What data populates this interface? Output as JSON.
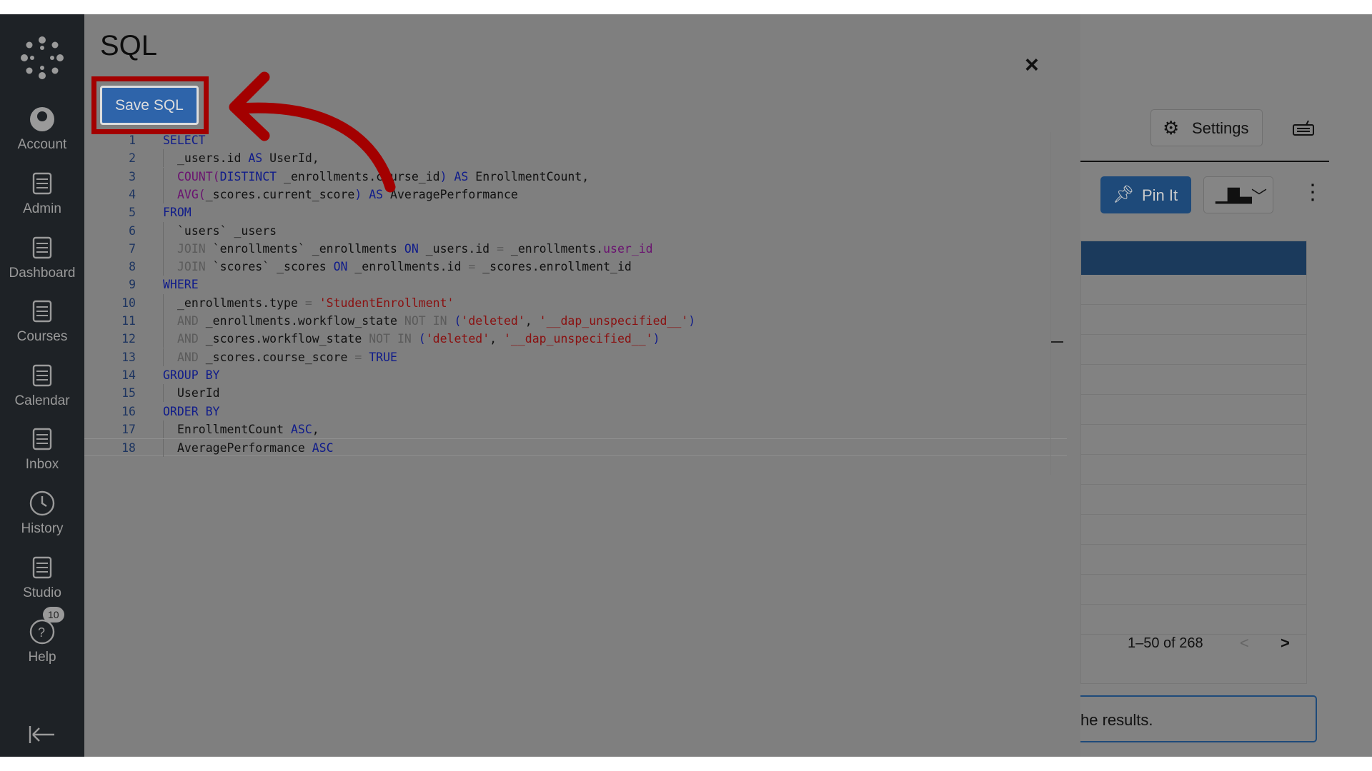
{
  "sidebar": {
    "items": [
      {
        "label": "Account",
        "icon": "account-icon"
      },
      {
        "label": "Admin",
        "icon": "admin-icon"
      },
      {
        "label": "Dashboard",
        "icon": "dashboard-icon"
      },
      {
        "label": "Courses",
        "icon": "courses-icon"
      },
      {
        "label": "Calendar",
        "icon": "calendar-icon"
      },
      {
        "label": "Inbox",
        "icon": "inbox-icon"
      },
      {
        "label": "History",
        "icon": "history-icon"
      },
      {
        "label": "Studio",
        "icon": "studio-icon"
      },
      {
        "label": "Help",
        "icon": "help-icon",
        "badge": "10"
      }
    ]
  },
  "modal": {
    "title": "SQL",
    "close": "×",
    "save_label": "Save SQL"
  },
  "code": [
    [
      [
        "k",
        "SELECT"
      ]
    ],
    [
      [
        "",
        "_users.id "
      ],
      [
        "k",
        "AS"
      ],
      [
        "",
        " UserId,"
      ]
    ],
    [
      [
        "f",
        "COUNT("
      ],
      [
        "k",
        "DISTINCT"
      ],
      [
        "",
        " _enrollments.course_id"
      ],
      [
        "k",
        ")"
      ],
      [
        "",
        " "
      ],
      [
        "k",
        "AS"
      ],
      [
        "",
        " EnrollmentCount,"
      ]
    ],
    [
      [
        "f",
        "AVG("
      ],
      [
        "",
        "_scores.current_score"
      ],
      [
        "k",
        ")"
      ],
      [
        "",
        " "
      ],
      [
        "k",
        "AS"
      ],
      [
        "",
        " AveragePerformance"
      ]
    ],
    [
      [
        "k",
        "FROM"
      ]
    ],
    [
      [
        "",
        "`users` _users"
      ]
    ],
    [
      [
        "o",
        "JOIN"
      ],
      [
        "",
        " `enrollments` _enrollments "
      ],
      [
        "k",
        "ON"
      ],
      [
        "",
        " _users.id "
      ],
      [
        "o",
        "="
      ],
      [
        "",
        " _enrollments."
      ],
      [
        "f",
        "user_id"
      ]
    ],
    [
      [
        "o",
        "JOIN"
      ],
      [
        "",
        " `scores` _scores "
      ],
      [
        "k",
        "ON"
      ],
      [
        "",
        " _enrollments.id "
      ],
      [
        "o",
        "="
      ],
      [
        "",
        " _scores.enrollment_id"
      ]
    ],
    [
      [
        "k",
        "WHERE"
      ]
    ],
    [
      [
        "",
        "_enrollments.type "
      ],
      [
        "o",
        "="
      ],
      [
        "",
        " "
      ],
      [
        "s",
        "'StudentEnrollment'"
      ]
    ],
    [
      [
        "o",
        "AND"
      ],
      [
        "",
        " _enrollments.workflow_state "
      ],
      [
        "o",
        "NOT IN"
      ],
      [
        "",
        " "
      ],
      [
        "k",
        "("
      ],
      [
        "s",
        "'deleted'"
      ],
      [
        "",
        ", "
      ],
      [
        "s",
        "'__dap_unspecified__'"
      ],
      [
        "k",
        ")"
      ]
    ],
    [
      [
        "o",
        "AND"
      ],
      [
        "",
        " _scores.workflow_state "
      ],
      [
        "o",
        "NOT IN"
      ],
      [
        "",
        " "
      ],
      [
        "k",
        "("
      ],
      [
        "s",
        "'deleted'"
      ],
      [
        "",
        ", "
      ],
      [
        "s",
        "'__dap_unspecified__'"
      ],
      [
        "k",
        ")"
      ]
    ],
    [
      [
        "o",
        "AND"
      ],
      [
        "",
        " _scores.course_score "
      ],
      [
        "o",
        "="
      ],
      [
        "",
        " "
      ],
      [
        "k",
        "TRUE"
      ]
    ],
    [
      [
        "k",
        "GROUP BY"
      ]
    ],
    [
      [
        "",
        "UserId"
      ]
    ],
    [
      [
        "k",
        "ORDER BY"
      ]
    ],
    [
      [
        "",
        "EnrollmentCount "
      ],
      [
        "k",
        "ASC"
      ],
      [
        "",
        ","
      ]
    ],
    [
      [
        "",
        "AveragePerformance "
      ],
      [
        "k",
        "ASC"
      ]
    ]
  ],
  "right": {
    "settings_label": "Settings",
    "pin_label": "Pin It",
    "pagination": "1–50 of 268",
    "prev": "<",
    "next": ">",
    "input_text": "he results."
  },
  "colors": {
    "annotation": "#a30000",
    "header": "#1b3a5c",
    "primary": "#2e64aa"
  }
}
